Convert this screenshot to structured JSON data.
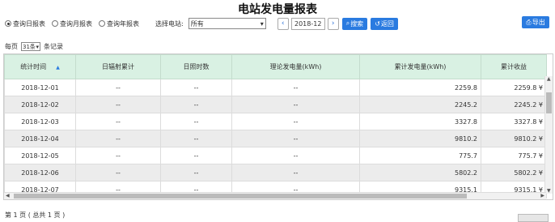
{
  "page_title": "电站发电量报表",
  "toolbar": {
    "radios": [
      {
        "label": "查询日报表",
        "checked": true
      },
      {
        "label": "查询月报表",
        "checked": false
      },
      {
        "label": "查询年报表",
        "checked": false
      }
    ],
    "station_label": "选择电站:",
    "station_value": "所有",
    "date_value": "2018-12",
    "search_label": "搜索",
    "back_label": "返回",
    "export_label": "导出"
  },
  "perpage": {
    "prefix": "每页",
    "value": "31条",
    "suffix": "条记录"
  },
  "table": {
    "headers": [
      "统计时间",
      "日辐射累计",
      "日照时数",
      "理论发电量(kWh)",
      "累计发电量(kWh)",
      "累计收益"
    ],
    "rows": [
      [
        "2018-12-01",
        "--",
        "--",
        "--",
        "2259.8",
        "2259.8 ¥"
      ],
      [
        "2018-12-02",
        "--",
        "--",
        "--",
        "2245.2",
        "2245.2 ¥"
      ],
      [
        "2018-12-03",
        "--",
        "--",
        "--",
        "3327.8",
        "3327.8 ¥"
      ],
      [
        "2018-12-04",
        "--",
        "--",
        "--",
        "9810.2",
        "9810.2 ¥"
      ],
      [
        "2018-12-05",
        "--",
        "--",
        "--",
        "775.7",
        "775.7 ¥"
      ],
      [
        "2018-12-06",
        "--",
        "--",
        "--",
        "5802.2",
        "5802.2 ¥"
      ],
      [
        "2018-12-07",
        "--",
        "--",
        "--",
        "9315.1",
        "9315.1 ¥"
      ]
    ]
  },
  "footer": {
    "text": "第 1 页 ( 总共 1 页 )"
  },
  "colors": {
    "accent": "#2a7be0",
    "header_bg": "#d9f1e3"
  }
}
